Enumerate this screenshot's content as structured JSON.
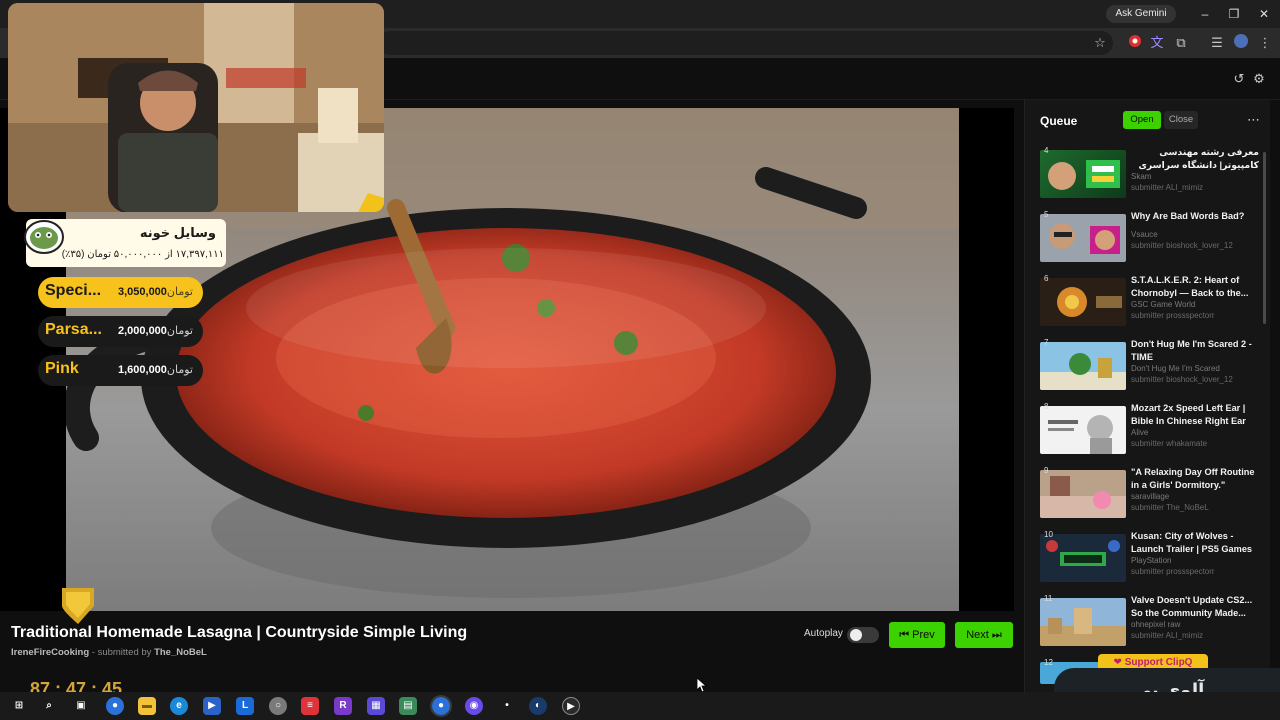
{
  "browser": {
    "ask_gemini": "Ask Gemini",
    "controls": [
      "minimize-icon",
      "restore-icon",
      "close-icon"
    ]
  },
  "webcam": {
    "description_label": ""
  },
  "donation_goal": {
    "title": "وسایل خونه",
    "progress_text": "۱۷,۳۹۷,۱۱۱ از ۵۰,۰۰۰,۰۰۰ تومان (۳۵٪)"
  },
  "top_donors": [
    {
      "name": "Speci...",
      "currency": "تومان",
      "amount": "3,050,000"
    },
    {
      "name": "Parsa...",
      "currency": "تومان",
      "amount": "2,000,000"
    },
    {
      "name": "Pink",
      "currency": "تومان",
      "amount": "1,600,000"
    }
  ],
  "video": {
    "title": "Traditional Homemade Lasagna | Countryside Simple Living",
    "channel": "IreneFireCooking",
    "submitted_by_label": " - submitted by ",
    "submitter": "The_NoBeL"
  },
  "controls": {
    "autoplay_label": "Autoplay",
    "prev_label": "Prev",
    "next_label": "Next"
  },
  "queue": {
    "title": "Queue",
    "open_label": "Open",
    "close_label": "Close",
    "items": [
      {
        "num": "4",
        "title": "معرفی رشته مهندسی کامپیوتر| دانشگاه سراسری یا آزاد؟؟؟",
        "channel": "Skam",
        "submitter": "submitter ALI_mimiz"
      },
      {
        "num": "5",
        "title": "Why Are Bad Words Bad?",
        "channel": "Vsauce",
        "submitter": "submitter bioshock_lover_12"
      },
      {
        "num": "6",
        "title": "S.T.A.L.K.E.R. 2: Heart of Chornobyl — Back to the...",
        "channel": "GSC Game World",
        "submitter": "submitter prossspectorr"
      },
      {
        "num": "7",
        "title": "Don't Hug Me I'm Scared 2 - TIME",
        "channel": "Don't Hug Me I'm Scared",
        "submitter": "submitter bioshock_lover_12"
      },
      {
        "num": "8",
        "title": "Mozart 2x Speed Left Ear | Bible In Chinese Right Ear",
        "channel": "Alive",
        "submitter": "submitter whakamate"
      },
      {
        "num": "9",
        "title": "\"A Relaxing Day Off Routine in a Girls' Dormitory.\"",
        "channel": "saravillage",
        "submitter": "submitter The_NoBeL"
      },
      {
        "num": "10",
        "title": "Kusan: City of Wolves - Launch Trailer | PS5 Games",
        "channel": "PlayStation",
        "submitter": "submitter prossspectorr"
      },
      {
        "num": "11",
        "title": "Valve Doesn't Update CS2... So the Community Made...",
        "channel": "ohnepixel raw",
        "submitter": "submitter ALI_mimiz"
      },
      {
        "num": "12",
        "title": "",
        "channel": "",
        "submitter": ""
      }
    ],
    "support_label": "Support ClipQ"
  },
  "timer": {
    "text": "87 : 47 : 45"
  },
  "watermark": {
    "text": "آلوی پی"
  },
  "colors": {
    "accent_green": "#3cd200",
    "donor_gold": "#f6c21b",
    "timer_gold": "#d4a63a"
  }
}
